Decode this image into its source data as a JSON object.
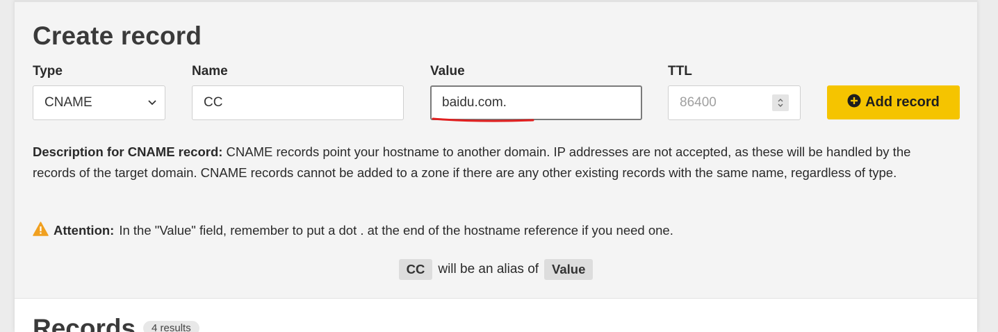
{
  "create": {
    "title": "Create record",
    "type_label": "Type",
    "name_label": "Name",
    "value_label": "Value",
    "ttl_label": "TTL",
    "type_value": "CNAME",
    "name_value": "CC",
    "value_value": "baidu.com.",
    "ttl_placeholder": "86400",
    "add_button_label": "Add record"
  },
  "description": {
    "heading": "Description for CNAME record:",
    "text": " CNAME records point your hostname to another domain. IP addresses are not accepted, as these will be handled by the records of the target domain. CNAME records cannot be added to a zone if there are any other existing records with the same name, regardless of type."
  },
  "attention": {
    "heading": "Attention:",
    "text": "In the \"Value\" field, remember to put a dot . at the end of the hostname reference if you need one."
  },
  "alias": {
    "name_tag": "CC",
    "middle_text": "will be an alias of",
    "value_tag": "Value"
  },
  "records": {
    "title": "Records",
    "count_badge": "4 results"
  },
  "icons": {
    "type_chevron": "chevron-down-icon",
    "ttl_spinner": "spinner-arrows-icon",
    "add": "plus-circle-icon",
    "warning": "warning-triangle-icon"
  },
  "colors": {
    "primary_button": "#f5c400",
    "warning": "#f0a020",
    "annotation_underline": "#e02020",
    "section_background": "#f4f4f4",
    "tag_background": "#dddddd"
  }
}
